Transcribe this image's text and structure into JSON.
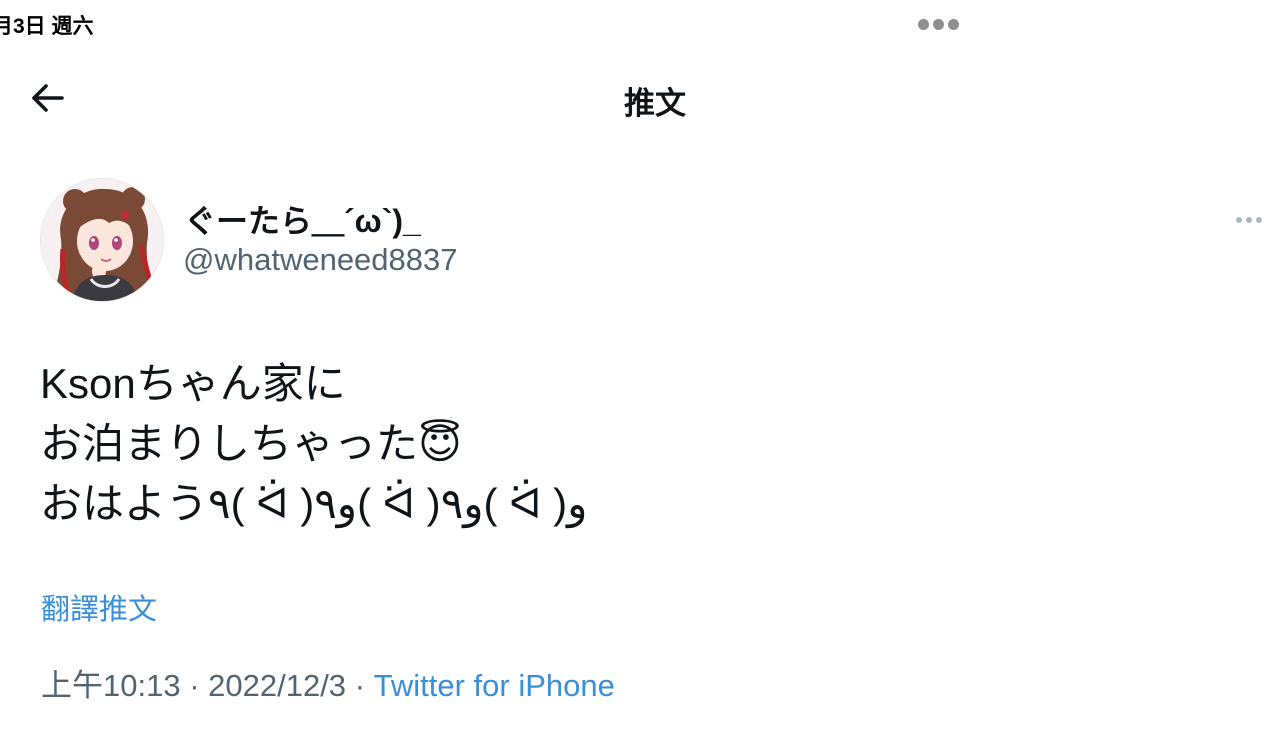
{
  "status_bar": {
    "date": "月3日 週六"
  },
  "header": {
    "title": "推文"
  },
  "tweet": {
    "author": {
      "display_name": "ぐーたら＿´ω`)_",
      "handle": "@whatweneed8837"
    },
    "text_lines": [
      "Ksonちゃん家に",
      "お泊まりしちゃった😇",
      "おはよう٩( ᐛ )و٩( ᐛ )و٩( ᐛ )و"
    ],
    "translate_label": "翻譯推文",
    "time": "上午10:13",
    "separator": "·",
    "date": "2022/12/3",
    "source": "Twitter for iPhone"
  },
  "colors": {
    "link": "#3b8fd8",
    "secondary_text": "#536471",
    "primary_text": "#0f1419"
  },
  "icons": {
    "back": "arrow-left-icon",
    "more": "more-horizontal-icon",
    "multitask": "multitask-dots-icon"
  }
}
